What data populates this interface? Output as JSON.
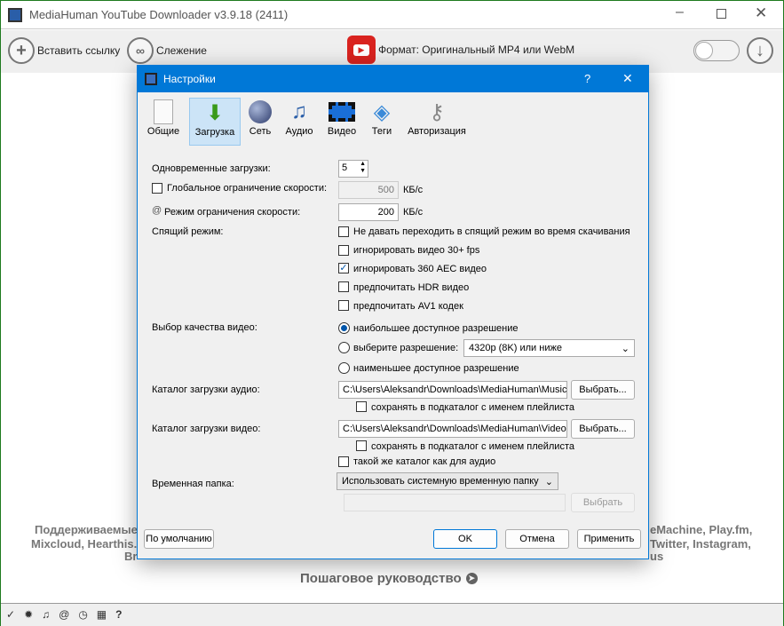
{
  "window": {
    "title": "MediaHuman YouTube Downloader v3.9.18 (2411)"
  },
  "toolbar": {
    "paste": "Вставить ссылку",
    "tracking": "Слежение",
    "format": "Формат: Оригинальный MP4 или WebM"
  },
  "background": {
    "line1_left": "Поддерживаемые",
    "line1_right": "eMachine, Play.fm,",
    "line2_left": "Mixcloud, Hearthis.",
    "line2_right": "Twitter, Instagram,",
    "line3_left": "Br",
    "line3_right": "us",
    "guide": "Пошаговое руководство"
  },
  "dialog": {
    "title": "Настройки",
    "help": "?",
    "tabs": [
      {
        "label": "Общие"
      },
      {
        "label": "Загрузка"
      },
      {
        "label": "Сеть"
      },
      {
        "label": "Аудио"
      },
      {
        "label": "Видео"
      },
      {
        "label": "Теги"
      },
      {
        "label": "Авторизация"
      }
    ],
    "concurrent_label": "Одновременные загрузки:",
    "concurrent_value": "5",
    "global_limit_label": "Глобальное ограничение скорости:",
    "global_limit_value": "500",
    "global_limit_unit": "КБ/с",
    "global_limit_checked": false,
    "limit_mode_label": "Режим ограничения скорости:",
    "limit_mode_value": "200",
    "limit_mode_unit": "КБ/с",
    "sleep_label": "Спящий режим:",
    "sleep_options": [
      {
        "label": "Не давать переходить в спящий режим во время скачивания",
        "checked": false
      },
      {
        "label": "игнорировать видео 30+ fps",
        "checked": false
      },
      {
        "label": "игнорировать 360 AEC видео",
        "checked": true
      },
      {
        "label": "предпочитать HDR видео",
        "checked": false
      },
      {
        "label": "предпочитать AV1 кодек",
        "checked": false
      }
    ],
    "quality_label": "Выбор качества видео:",
    "quality_options": [
      {
        "label": "наибольшее доступное разрешение",
        "selected": true
      },
      {
        "label": "выберите разрешение:",
        "selected": false
      },
      {
        "label": "наименьшее доступное разрешение",
        "selected": false
      }
    ],
    "resolution_value": "4320p (8K) или ниже",
    "audio_dir_label": "Каталог загрузки аудио:",
    "audio_dir_value": "C:\\Users\\Aleksandr\\Downloads\\MediaHuman\\Music",
    "browse": "Выбрать...",
    "audio_subdir": "сохранять в подкаталог с именем плейлиста",
    "video_dir_label": "Каталог загрузки видео:",
    "video_dir_value": "C:\\Users\\Aleksandr\\Downloads\\MediaHuman\\Video",
    "video_subdir": "сохранять в подкаталог с именем плейлиста",
    "same_as_audio": "такой же каталог как для аудио",
    "temp_label": "Временная папка:",
    "temp_value": "Использовать системную временную папку",
    "temp_browse": "Выбрать",
    "defaults": "По умолчанию",
    "ok": "OK",
    "cancel": "Отмена",
    "apply": "Применить"
  }
}
